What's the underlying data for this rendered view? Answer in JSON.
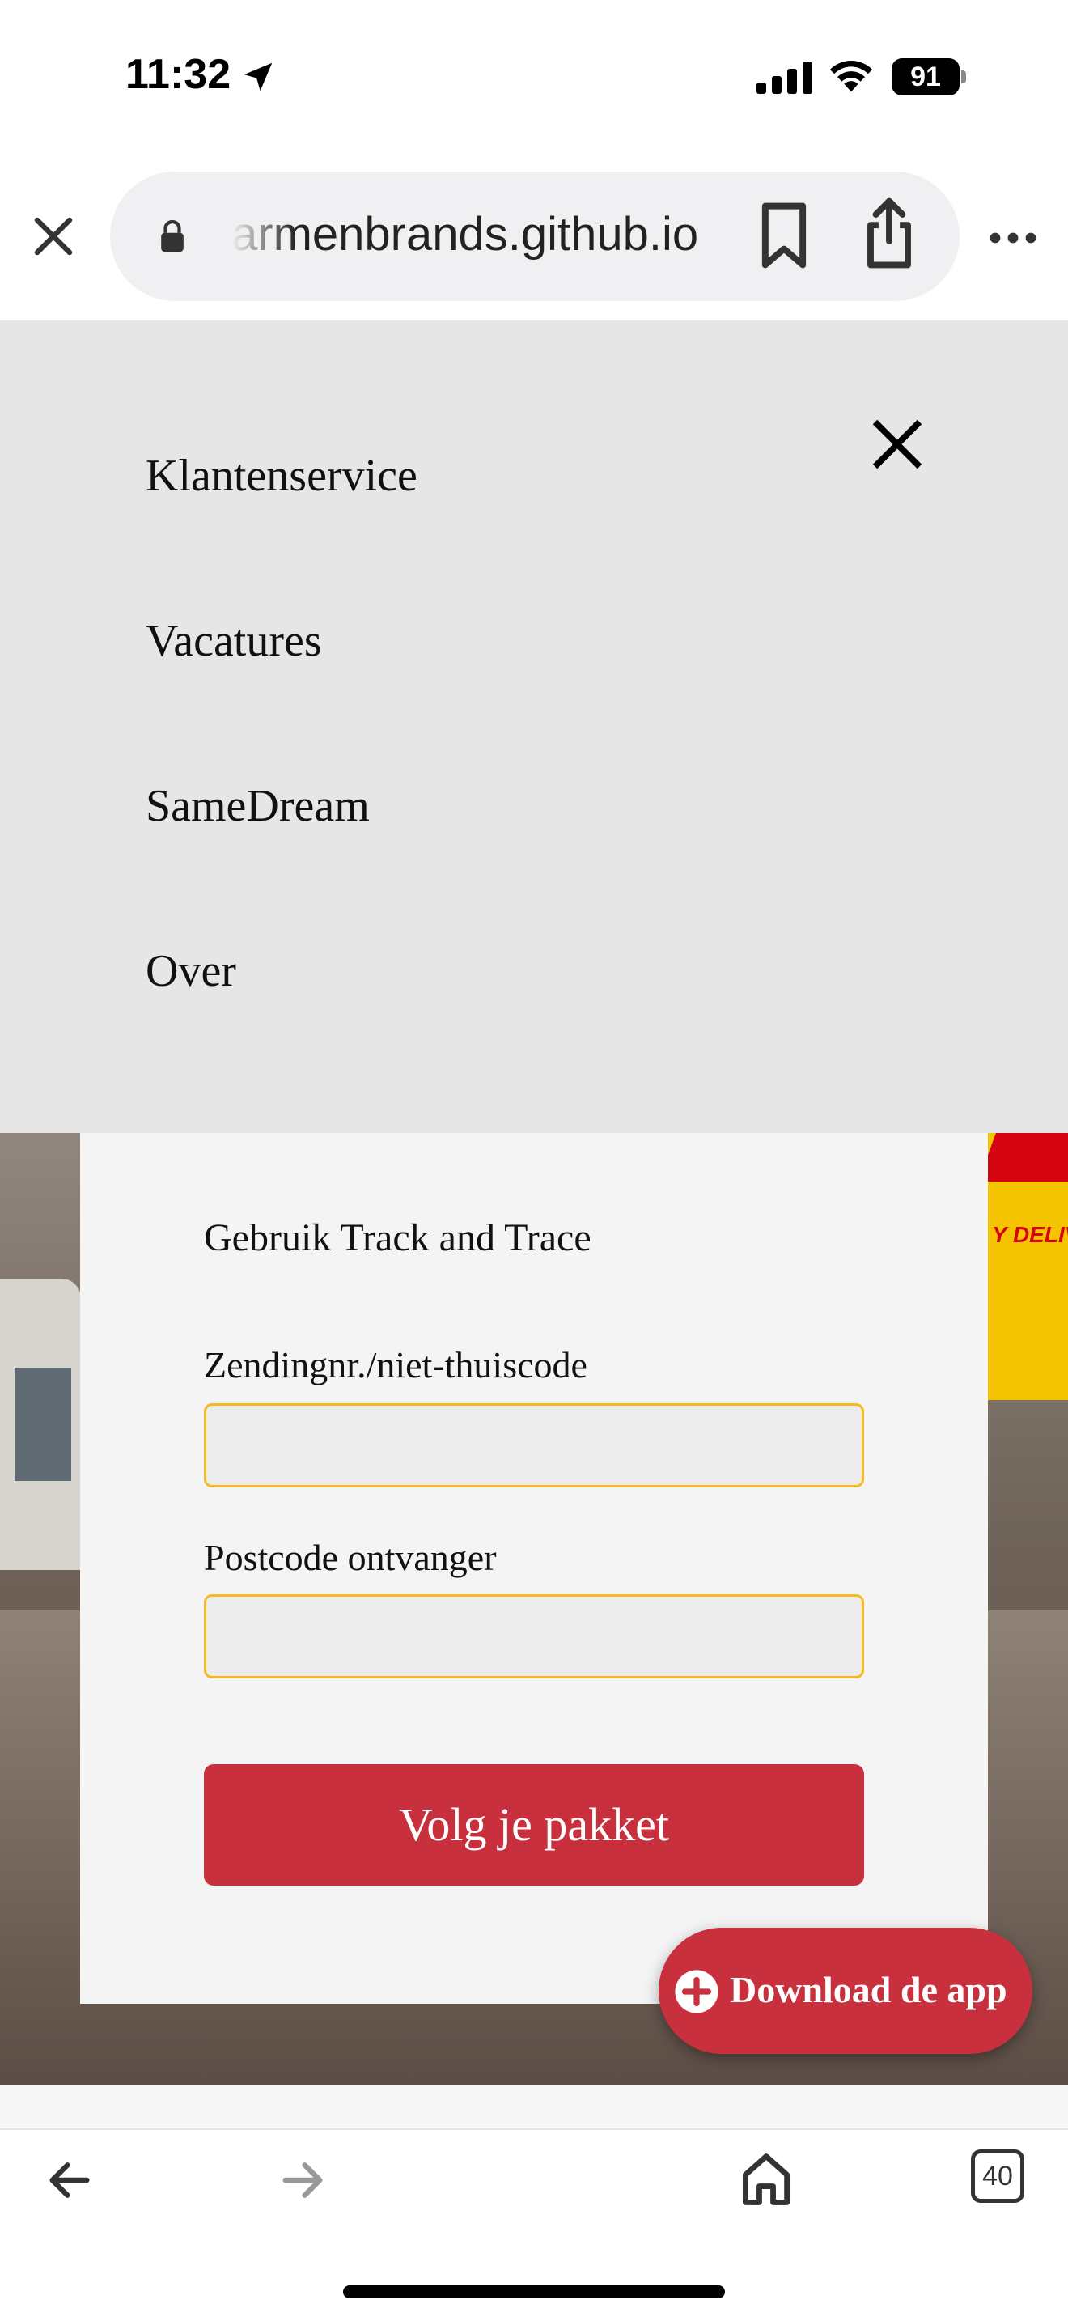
{
  "status_bar": {
    "time": "11:32",
    "battery": "91"
  },
  "browser": {
    "url": "armenbrands.github.io"
  },
  "menu": {
    "items": [
      {
        "label": "Klantenservice"
      },
      {
        "label": "Vacatures"
      },
      {
        "label": "SameDream"
      },
      {
        "label": "Over"
      }
    ]
  },
  "track_form": {
    "title": "Gebruik Track and Trace",
    "shipment_label": "Zendingnr./niet-thuiscode",
    "shipment_value": "",
    "postcode_label": "Postcode ontvanger",
    "postcode_value": "",
    "submit_label": "Volg je pakket"
  },
  "background": {
    "truck_text": "Y DELIV"
  },
  "download": {
    "label": "Download de app"
  },
  "toolbar": {
    "tab_count": "40"
  },
  "colors": {
    "accent_red": "#c8303e",
    "input_border": "#f3bb22",
    "menu_bg": "#e6e6e6"
  }
}
